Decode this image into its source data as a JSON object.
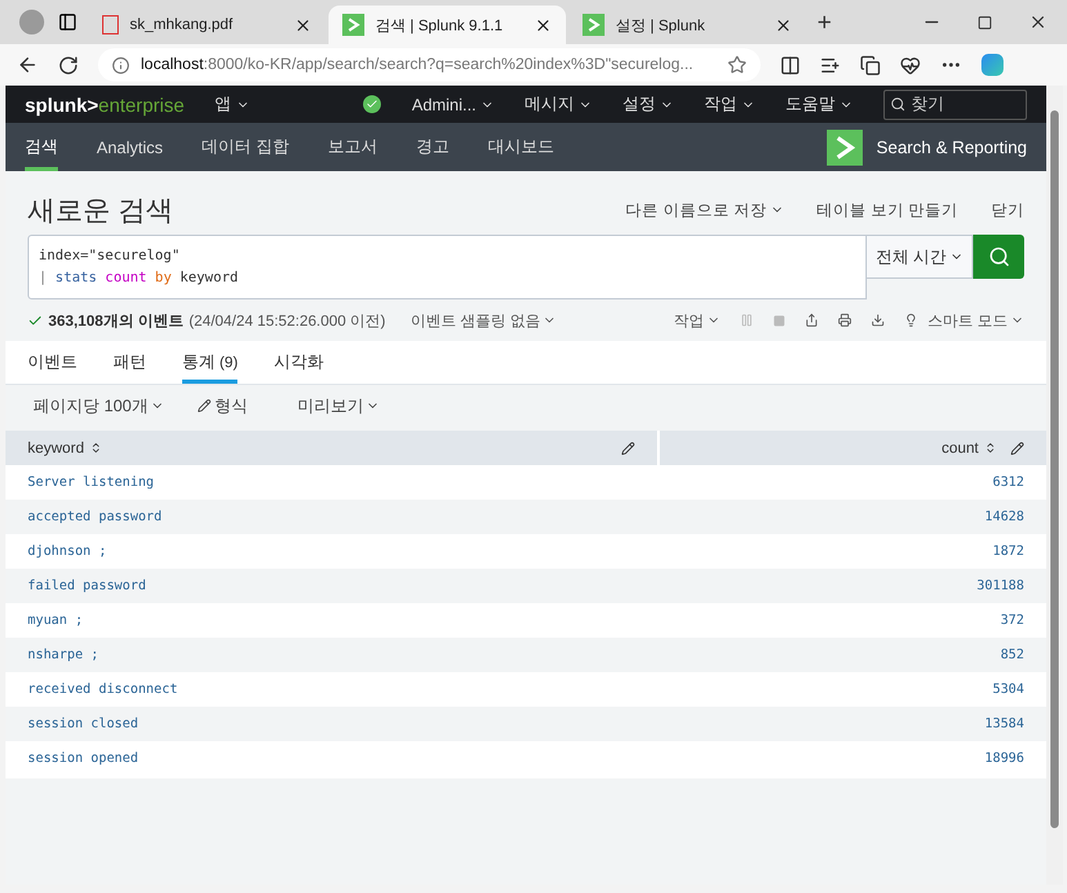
{
  "browser": {
    "tabs": [
      {
        "title": "sk_mhkang.pdf",
        "kind": "pdf",
        "selected": false
      },
      {
        "title": "검색 | Splunk 9.1.1",
        "kind": "splunk",
        "selected": true
      },
      {
        "title": "설정 | Splunk",
        "kind": "splunk",
        "selected": false
      }
    ],
    "new_tab": "+",
    "url_host": "localhost",
    "url_rest": ":8000/ko-KR/app/search/search?q=search%20index%3D\"securelog..."
  },
  "top_bar": {
    "logo_left": "splunk>",
    "logo_right": "enterprise",
    "app_menu": "앱",
    "user": "Admini...",
    "menus": [
      "메시지",
      "설정",
      "작업",
      "도움말"
    ],
    "search_placeholder": "찾기"
  },
  "app_nav": {
    "items": [
      {
        "label": "검색",
        "selected": true
      },
      {
        "label": "Analytics",
        "selected": false
      },
      {
        "label": "데이터 집합",
        "selected": false
      },
      {
        "label": "보고서",
        "selected": false
      },
      {
        "label": "경고",
        "selected": false
      },
      {
        "label": "대시보드",
        "selected": false
      }
    ],
    "app_name": "Search & Reporting"
  },
  "page": {
    "title": "새로운 검색",
    "actions": [
      {
        "label": "다른 이름으로 저장",
        "dropdown": true
      },
      {
        "label": "테이블 보기 만들기",
        "dropdown": false
      },
      {
        "label": "닫기",
        "dropdown": false
      }
    ]
  },
  "query": {
    "lines": [
      [
        {
          "text": "index=\"securelog\"",
          "kind": "plain"
        }
      ],
      [
        {
          "text": "| ",
          "kind": "pipe"
        },
        {
          "text": "stats ",
          "kind": "command"
        },
        {
          "text": "count ",
          "kind": "function"
        },
        {
          "text": "by ",
          "kind": "keyword"
        },
        {
          "text": "keyword",
          "kind": "plain"
        }
      ]
    ],
    "time_range": "전체 시간"
  },
  "status": {
    "count": "363,108개의 이벤트",
    "detail": "(24/04/24 15:52:26.000 이전)",
    "sampling": "이벤트 샘플링 없음",
    "job": "작업",
    "mode": "스마트 모드"
  },
  "result_tabs": [
    {
      "label": "이벤트",
      "selected": false
    },
    {
      "label": "패턴",
      "selected": false
    },
    {
      "label": "통계",
      "count": "(9)",
      "selected": true
    },
    {
      "label": "시각화",
      "selected": false
    }
  ],
  "toolbar": {
    "per_page": "페이지당 100개",
    "format": "형식",
    "preview": "미리보기"
  },
  "table": {
    "columns": [
      "keyword",
      "count"
    ],
    "rows": [
      [
        "Server listening",
        "6312"
      ],
      [
        "accepted password",
        "14628"
      ],
      [
        "djohnson ;",
        "1872"
      ],
      [
        "failed password",
        "301188"
      ],
      [
        "myuan ;",
        "372"
      ],
      [
        "nsharpe ;",
        "852"
      ],
      [
        "received disconnect",
        "5304"
      ],
      [
        "session closed",
        "13584"
      ],
      [
        "session opened",
        "18996"
      ]
    ]
  }
}
